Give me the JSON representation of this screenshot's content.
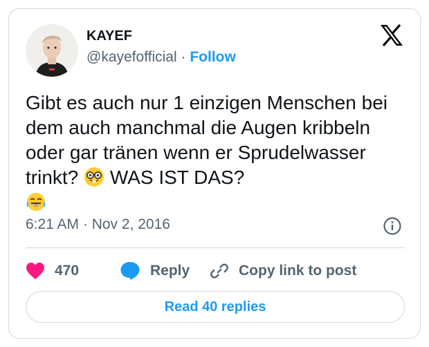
{
  "author": {
    "name": "KAYEF",
    "handle": "@kayefofficial",
    "separator": " · ",
    "follow_label": "Follow"
  },
  "tweet": {
    "text_main": "Gibt es auch nur 1 einzigen Menschen bei dem auch manchmal die Augen kribbeln oder gar tränen wenn er Sprudelwasser trinkt?",
    "text_shout": "WAS IST DAS?",
    "emojis": [
      "nerd-face",
      "tears-of-joy"
    ],
    "timestamp": "6:21 AM · Nov 2, 2016"
  },
  "actions": {
    "likes_count": "470",
    "reply_label": "Reply",
    "copy_link_label": "Copy link to post"
  },
  "read_replies_label": "Read 40 replies",
  "colors": {
    "accent": "#1d9bf0",
    "heart": "#f91880",
    "muted_text": "#536471",
    "border": "#cfd9de"
  }
}
